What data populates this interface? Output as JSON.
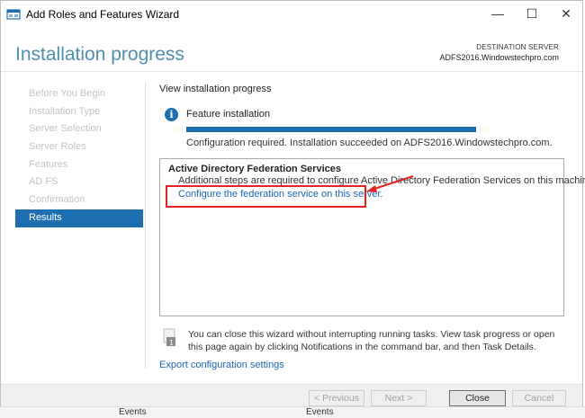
{
  "window": {
    "title": "Add Roles and Features Wizard",
    "controls": {
      "minimize": "—",
      "maximize": "☐",
      "close": "✕"
    }
  },
  "header": {
    "title": "Installation progress",
    "destination_label": "DESTINATION SERVER",
    "destination_value": "ADFS2016.Windowstechpro.com"
  },
  "sidebar": {
    "items": [
      {
        "label": "Before You Begin",
        "state": "disabled"
      },
      {
        "label": "Installation Type",
        "state": "disabled"
      },
      {
        "label": "Server Selection",
        "state": "disabled"
      },
      {
        "label": "Server Roles",
        "state": "disabled"
      },
      {
        "label": "Features",
        "state": "disabled"
      },
      {
        "label": "AD FS",
        "state": "disabled"
      },
      {
        "label": "Confirmation",
        "state": "disabled"
      },
      {
        "label": "Results",
        "state": "active"
      }
    ]
  },
  "content": {
    "heading": "View installation progress",
    "feature_label": "Feature installation",
    "progress_percent": 100,
    "status": "Configuration required. Installation succeeded on ADFS2016.Windowstechpro.com.",
    "result_title": "Active Directory Federation Services",
    "result_desc": "Additional steps are required to configure Active Directory Federation Services on this machine.",
    "result_link": "Configure the federation service on this server.",
    "note": "You can close this wizard without interrupting running tasks. View task progress or open this page again by clicking Notifications in the command bar, and then Task Details.",
    "export_link": "Export configuration settings"
  },
  "buttons": {
    "previous": "< Previous",
    "next": "Next >",
    "close": "Close",
    "cancel": "Cancel"
  },
  "background": {
    "left_text": "Events",
    "right_text": "Events"
  },
  "colors": {
    "accent": "#1e6fb2",
    "header_title": "#4f8fb0",
    "link": "#1a67b0",
    "annotation_red": "#e32420"
  }
}
